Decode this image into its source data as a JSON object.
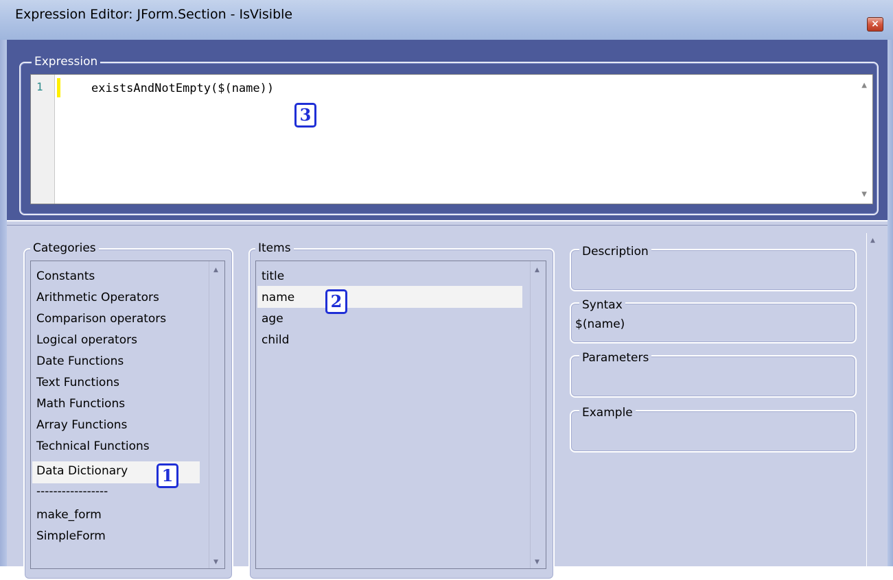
{
  "window": {
    "title": "Expression Editor: JForm.Section - IsVisible",
    "close_glyph": "×"
  },
  "expression": {
    "label": "Expression",
    "line_number": "1",
    "code": "existsAndNotEmpty($(name))"
  },
  "categories": {
    "label": "Categories",
    "items": [
      "Constants",
      "Arithmetic Operators",
      "Comparison operators",
      "Logical operators",
      "Date Functions",
      "Text Functions",
      "Math Functions",
      "Array Functions",
      "Technical Functions",
      "Data Dictionary",
      "-----------------",
      "make_form",
      "SimpleForm"
    ],
    "selected": "Data Dictionary"
  },
  "items_panel": {
    "label": "Items",
    "items": [
      "title",
      "name",
      "age",
      "child"
    ],
    "selected": "name"
  },
  "details": {
    "description_label": "Description",
    "description_value": "",
    "syntax_label": "Syntax",
    "syntax_value": "$(name)",
    "parameters_label": "Parameters",
    "parameters_value": "",
    "example_label": "Example",
    "example_value": ""
  },
  "badges": {
    "one": "1",
    "two": "2",
    "three": "3"
  },
  "colors": {
    "badge": "#1f2fd6",
    "expression_bg": "#4c5a9a",
    "panel_bg": "#c9cfe6",
    "selection": "#f3f3f3"
  }
}
